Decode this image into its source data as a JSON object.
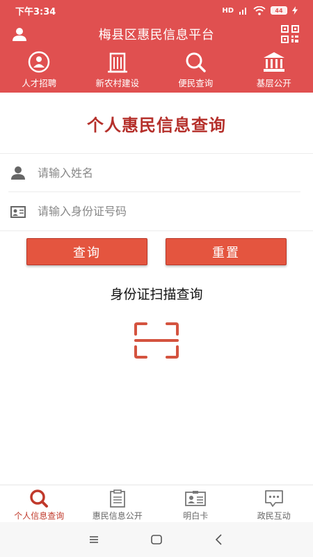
{
  "status_bar": {
    "time": "下午3:34",
    "network": "HD",
    "battery": "44"
  },
  "header": {
    "title": "梅县区惠民信息平台"
  },
  "quick_nav": [
    {
      "label": "人才招聘",
      "icon": "talent-icon"
    },
    {
      "label": "新农村建设",
      "icon": "building-icon"
    },
    {
      "label": "便民查询",
      "icon": "search-icon"
    },
    {
      "label": "基层公开",
      "icon": "bank-icon"
    }
  ],
  "main": {
    "page_title": "个人惠民信息查询",
    "name_field": {
      "placeholder": "请输入姓名",
      "value": ""
    },
    "id_field": {
      "placeholder": "请输入身份证号码",
      "value": ""
    },
    "query_button": "查询",
    "reset_button": "重置",
    "scan_label": "身份证扫描查询"
  },
  "bottom_nav": [
    {
      "label": "个人信息查询",
      "icon": "search-icon",
      "active": true
    },
    {
      "label": "惠民信息公开",
      "icon": "clipboard-icon",
      "active": false
    },
    {
      "label": "明白卡",
      "icon": "id-card-icon",
      "active": false
    },
    {
      "label": "政民互动",
      "icon": "chat-icon",
      "active": false
    }
  ],
  "colors": {
    "primary": "#e05050",
    "button": "#e4553f",
    "title": "#b5302b",
    "active_tab": "#c0392b"
  }
}
